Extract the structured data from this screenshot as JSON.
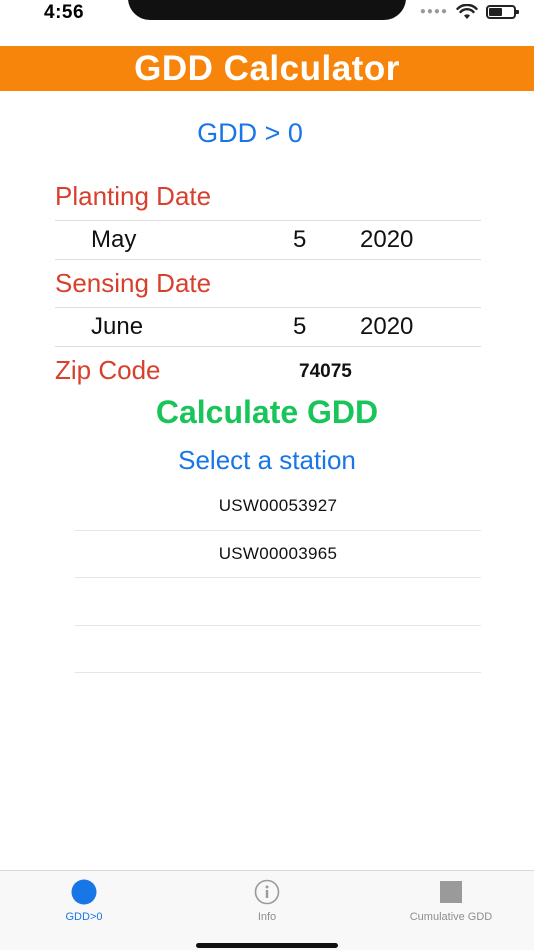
{
  "status": {
    "time": "4:56"
  },
  "app": {
    "title": "GDD Calculator"
  },
  "mode_title": "GDD > 0",
  "planting": {
    "label": "Planting Date",
    "month": "May",
    "day": "5",
    "year": "2020"
  },
  "sensing": {
    "label": "Sensing Date",
    "month": "June",
    "day": "5",
    "year": "2020"
  },
  "zip": {
    "label": "Zip Code",
    "value": "74075"
  },
  "calculate_label": "Calculate GDD",
  "select_station_label": "Select a station",
  "stations": [
    "USW00053927",
    "USW00003965",
    "",
    ""
  ],
  "tabs": [
    {
      "label": "GDD>0",
      "icon": "filled-circle-icon",
      "active": true
    },
    {
      "label": "Info",
      "icon": "info-circle-icon",
      "active": false
    },
    {
      "label": "Cumulative GDD",
      "icon": "square-icon",
      "active": false
    }
  ],
  "colors": {
    "header": "#f7850c",
    "blue": "#1976e6",
    "red_label": "#d8402e",
    "green": "#19c45a"
  }
}
